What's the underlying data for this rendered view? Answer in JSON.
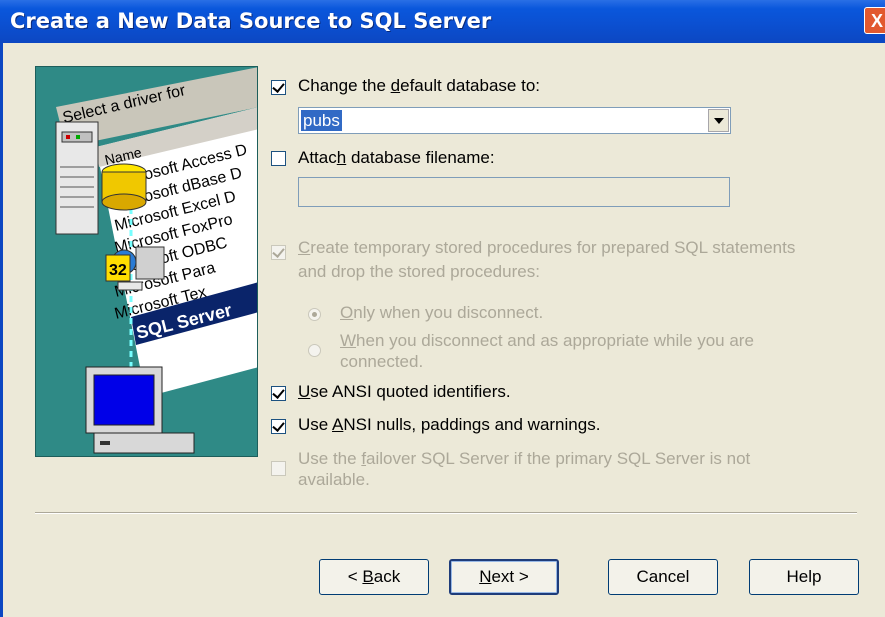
{
  "window": {
    "title": "Create a New Data Source to SQL Server",
    "close_label": "X"
  },
  "art": {
    "header": "Select a driver for",
    "col_header": "Name",
    "drivers": [
      "Microsoft Access D",
      "Microsoft dBase D",
      "Microsoft Excel D",
      "Microsoft FoxPro",
      "Microsoft ODBC",
      "Microsoft Para",
      "Microsoft Tex",
      "SQL Server"
    ],
    "badge": "32"
  },
  "options": {
    "change_db": {
      "label_pre": "Change the ",
      "label_key": "d",
      "label_post": "efault database to:",
      "checked": true
    },
    "database_value": "pubs",
    "attach": {
      "label_pre": "Attac",
      "label_key": "h",
      "label_post": " database filename:",
      "checked": false,
      "value": ""
    },
    "temp_procs": {
      "line1_key": "C",
      "line1": "reate temporary stored procedures for prepared SQL statements",
      "line2": "and drop the stored procedures:",
      "checked": true
    },
    "radio_only": {
      "key": "O",
      "label": "nly when you disconnect.",
      "selected": true
    },
    "radio_when": {
      "key": "W",
      "line1": "hen you disconnect and as appropriate while you are",
      "line2": "connected.",
      "selected": false
    },
    "ansi_quoted": {
      "key": "U",
      "label": "se ANSI quoted identifiers.",
      "checked": true
    },
    "ansi_nulls": {
      "pre": "Use ",
      "key": "A",
      "post": "NSI nulls, paddings and warnings.",
      "checked": true
    },
    "failover": {
      "pre": "Use the ",
      "key": "f",
      "line1": "ailover SQL Server if the primary SQL Server is not",
      "line2": "available.",
      "checked": false
    }
  },
  "buttons": {
    "back": {
      "pre": "< ",
      "key": "B",
      "post": "ack"
    },
    "next": {
      "key": "N",
      "post": "ext >"
    },
    "cancel": "Cancel",
    "help": "Help"
  }
}
